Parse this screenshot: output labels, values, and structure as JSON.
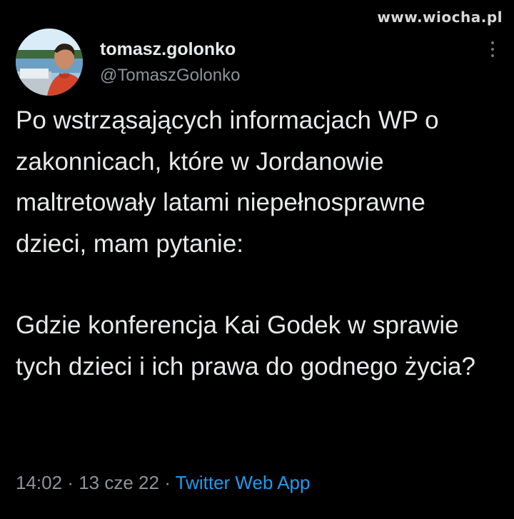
{
  "watermark": "www.wiocha.pl",
  "tweet": {
    "display_name": "tomasz.golonko",
    "handle": "@TomaszGolonko",
    "paragraphs": [
      "Po wstrząsających informacjach WP o zakonnicach, które w Jordanowie maltretowały latami niepełnosprawne dzieci, mam pytanie:",
      "Gdzie konferencja Kai Godek w sprawie tych dzieci i ich prawa do godnego życia?"
    ],
    "time": "14:02",
    "separator": "·",
    "date": "13 cze 22",
    "source": "Twitter Web App"
  },
  "colors": {
    "background": "#000000",
    "text": "#e7e9ea",
    "secondary": "#8b949a",
    "link": "#1d9bf0"
  },
  "icons": {
    "more": "more-vertical-icon"
  }
}
